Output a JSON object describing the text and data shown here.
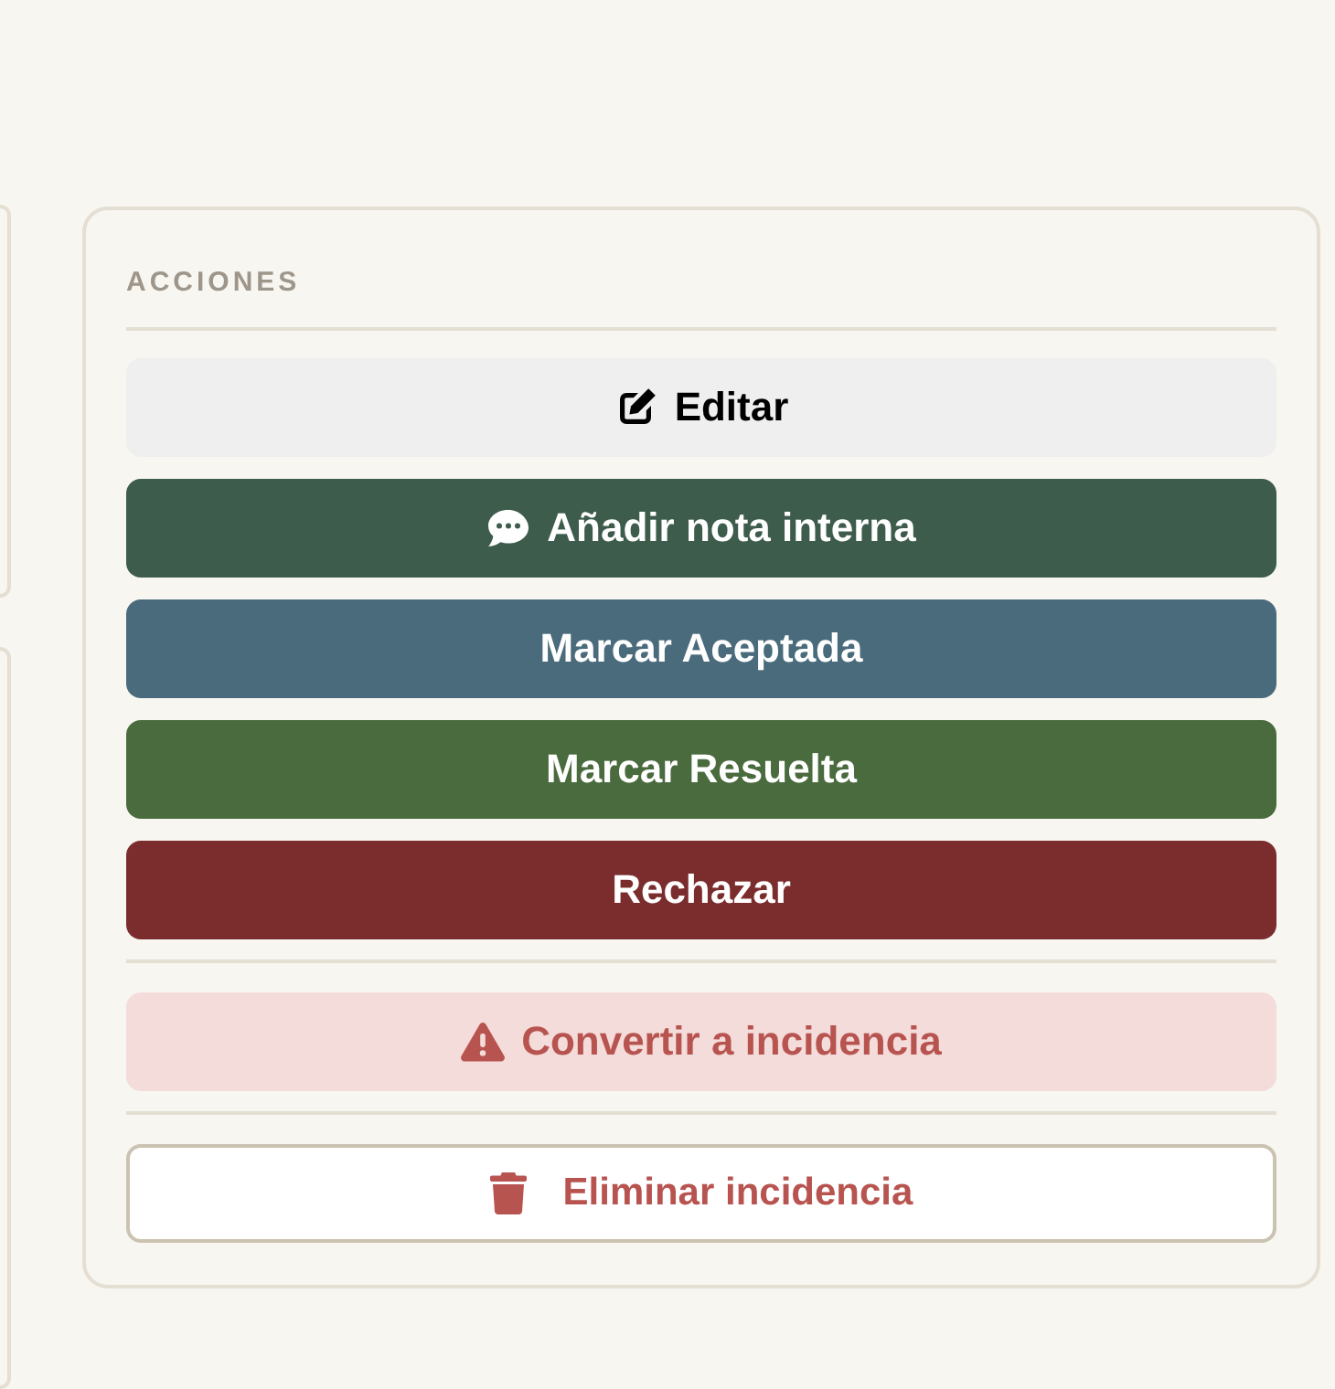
{
  "actions_panel": {
    "heading": "ACCIONES",
    "groups": [
      {
        "buttons": [
          {
            "kind": "edit",
            "label": "Editar"
          },
          {
            "kind": "note",
            "label": "Añadir nota interna"
          },
          {
            "kind": "accept",
            "label": "Marcar Aceptada"
          },
          {
            "kind": "resolve",
            "label": "Marcar Resuelta"
          },
          {
            "kind": "reject",
            "label": "Rechazar"
          }
        ]
      },
      {
        "buttons": [
          {
            "kind": "convert",
            "label": "Convertir a incidencia"
          }
        ]
      },
      {
        "buttons": [
          {
            "kind": "delete",
            "label": "Eliminar incidencia"
          }
        ]
      }
    ]
  }
}
